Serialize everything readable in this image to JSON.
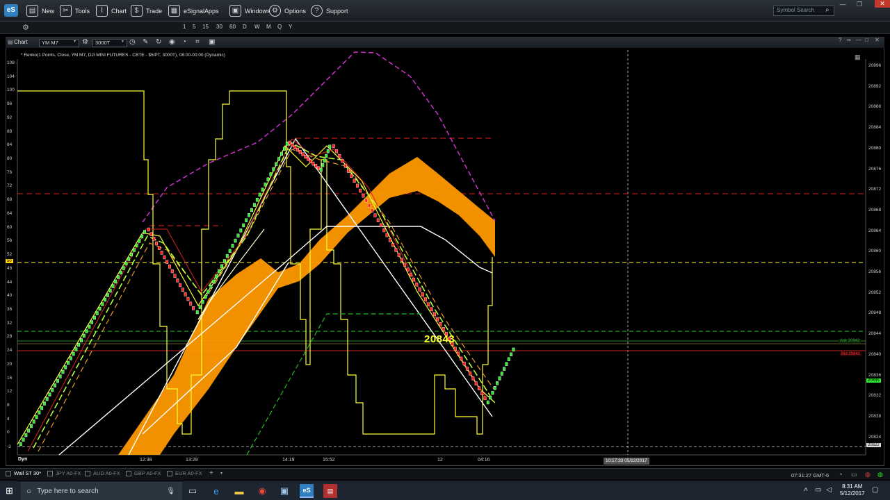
{
  "menu": {
    "logo": "eS",
    "items": [
      {
        "label": "New",
        "icon": "new-window-icon"
      },
      {
        "label": "Tools",
        "icon": "tools-icon"
      },
      {
        "label": "Chart",
        "icon": "chart-icon"
      },
      {
        "label": "Trade",
        "icon": "trade-icon"
      },
      {
        "label": "eSignalApps",
        "icon": "apps-icon"
      },
      {
        "label": "Windows",
        "icon": "windows-icon"
      },
      {
        "label": "Options",
        "icon": "gear-icon"
      },
      {
        "label": "Support",
        "icon": "help-icon"
      }
    ],
    "symbol_search_placeholder": "Symbol Search"
  },
  "intervals": [
    "1",
    "5",
    "15",
    "30",
    "60",
    "D",
    "W",
    "M",
    "Q",
    "Y"
  ],
  "chart_window": {
    "title": "Chart",
    "symbol": "YM M7",
    "interval": "3000T",
    "study_label": "* Renko(1 Points, Close, YM M7, DJI MINI FUTURES - CBTE - $5/PT, 3000T), 08:00-00:00 (Dynamic)"
  },
  "left_axis": [
    "108",
    "104",
    "100",
    "96",
    "92",
    "88",
    "84",
    "80",
    "76",
    "72",
    "68",
    "64",
    "60",
    "56",
    "52",
    "48",
    "44",
    "40",
    "36",
    "32",
    "28",
    "24",
    "20",
    "16",
    "12",
    "8",
    "4",
    "0",
    "-3"
  ],
  "left_axis_marker": "50",
  "right_axis": [
    "20896",
    "20892",
    "20888",
    "20884",
    "20880",
    "20876",
    "20872",
    "20868",
    "20864",
    "20860",
    "20856",
    "20852",
    "20848",
    "20844",
    "20840",
    "20836",
    "20832",
    "20828",
    "20824"
  ],
  "right_axis_tags": {
    "ask": "Ask 20842",
    "bid": "Bid 20841",
    "last": "20835",
    "bottom": "20822"
  },
  "x_axis": {
    "mode": "Dyn",
    "labels": [
      "12:38",
      "13:29",
      "14:19",
      "15:52",
      "12",
      "04:16"
    ],
    "cursor_time": "10:17:33 05/12/2017"
  },
  "big_price": "20843",
  "tabs": [
    "Wall ST 30*",
    "JPY A0-FX",
    "AUD A0-FX",
    "GBP A0-FX",
    "EUR A0-FX"
  ],
  "status_time": "07:31:27 GMT-6",
  "taskbar": {
    "search_placeholder": "Type here to search",
    "time": "8:31 AM",
    "date": "5/12/2017"
  },
  "colors": {
    "background": "#000000",
    "renko_up": "#2ee82e",
    "renko_down": "#ff2020",
    "cloud": "#ff9900",
    "channel": "#ffff33",
    "envelope": "#cc33cc"
  }
}
